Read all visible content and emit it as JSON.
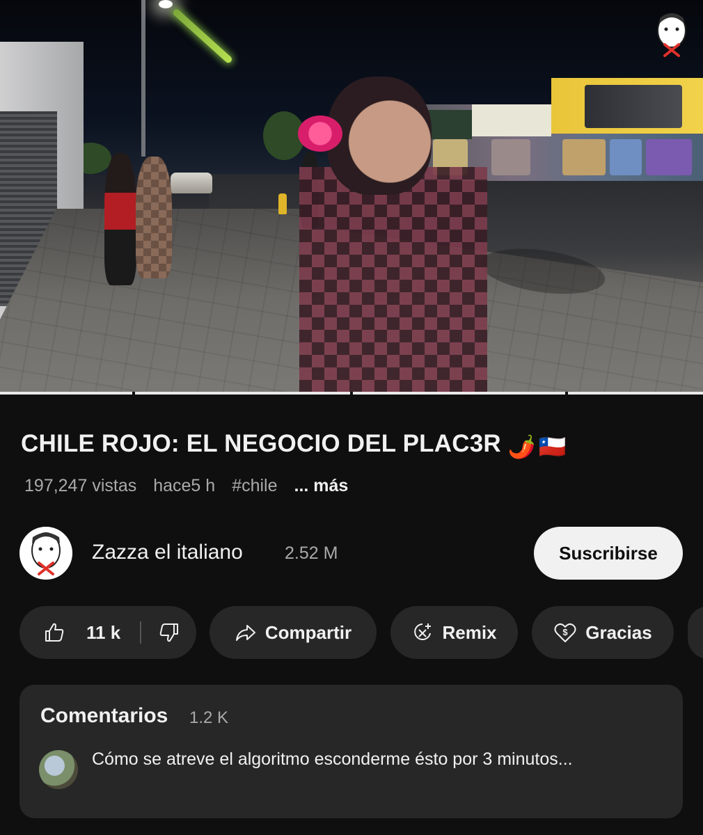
{
  "video": {
    "progress_segments": 4,
    "watermark_icon": "channel-logo-watermark"
  },
  "title": {
    "text": "CHILE ROJO: EL NEGOCIO DEL PLAC3R",
    "emojis": [
      "🌶️",
      "🇨🇱"
    ]
  },
  "meta": {
    "views": "197,247 vistas",
    "age": "hace5 h",
    "hashtag": "#chile",
    "more": "... más"
  },
  "channel": {
    "name": "Zazza el italiano",
    "subscribers": "2.52 M",
    "subscribe_label": "Suscribirse"
  },
  "actions": {
    "likes": "11 k",
    "share_label": "Compartir",
    "remix_label": "Remix",
    "thanks_label": "Gracias"
  },
  "comments": {
    "heading": "Comentarios",
    "count": "1.2 K",
    "top_comment": "Cómo se atreve el algoritmo esconderme ésto por 3 minutos..."
  },
  "colors": {
    "background": "#0f0f0f",
    "pill": "#272727",
    "text_primary": "#f1f1f1",
    "text_secondary": "#aaaaaa",
    "subscribe_bg": "#f1f1f1"
  }
}
